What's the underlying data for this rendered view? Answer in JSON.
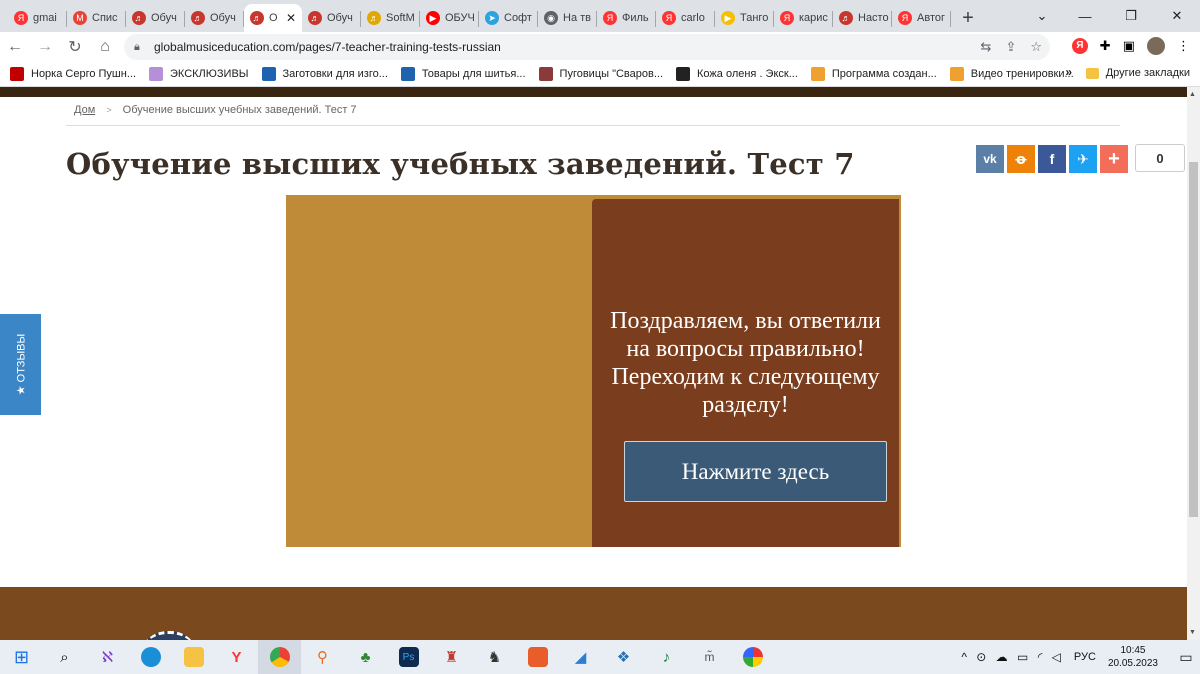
{
  "browser": {
    "tabs": [
      {
        "label": "gmai",
        "color": "#f33",
        "glyph": "Я"
      },
      {
        "label": "Спис",
        "color": "#ea4335",
        "glyph": "M"
      },
      {
        "label": "Обуч",
        "color": "#c8372d",
        "glyph": "♬"
      },
      {
        "label": "Обуч",
        "color": "#c8372d",
        "glyph": "♬"
      },
      {
        "label": "О",
        "color": "#c8372d",
        "glyph": "♬",
        "active": true
      },
      {
        "label": "Обуч",
        "color": "#c8372d",
        "glyph": "♬"
      },
      {
        "label": "SoftM",
        "color": "#e0a800",
        "glyph": "♬"
      },
      {
        "label": "ОБУЧ",
        "color": "#ff0000",
        "glyph": "▶"
      },
      {
        "label": "Софт",
        "color": "#2aa3df",
        "glyph": "➤"
      },
      {
        "label": "На тв",
        "color": "#5f6368",
        "glyph": "◉"
      },
      {
        "label": "Филь",
        "color": "#f33",
        "glyph": "Я"
      },
      {
        "label": "carlo",
        "color": "#f33",
        "glyph": "Я"
      },
      {
        "label": "Танго",
        "color": "#f5c000",
        "glyph": "▶"
      },
      {
        "label": "карис",
        "color": "#f33",
        "glyph": "Я"
      },
      {
        "label": "Насто",
        "color": "#c8372d",
        "glyph": "♬"
      },
      {
        "label": "Автог",
        "color": "#f33",
        "glyph": "Я"
      }
    ],
    "new_tab": "+",
    "tab_close": "✕",
    "url": "globalmusiceducation.com/pages/7-teacher-training-tests-russian",
    "bookmarks": [
      {
        "label": "Норка Серго Пушн...",
        "color": "#c00000"
      },
      {
        "label": "ЭКСКЛЮЗИВЫ",
        "color": "#b58fd8"
      },
      {
        "label": "Заготовки для изго...",
        "color": "#1e62b0"
      },
      {
        "label": "Товары для шитья...",
        "color": "#1e62b0"
      },
      {
        "label": "Пуговицы \"Сваров...",
        "color": "#8b3a3a"
      },
      {
        "label": "Кожа оленя . Экск...",
        "color": "#222"
      },
      {
        "label": "Программа создан...",
        "color": "#f0a030"
      },
      {
        "label": "Видео тренировки...",
        "color": "#f0a030"
      }
    ],
    "bookmarks_more": "»",
    "other_bookmarks": "Другие закладки"
  },
  "page": {
    "breadcrumb_home": "Дом",
    "breadcrumb_sep": ">",
    "breadcrumb_current": "Обучение высших учебных заведений. Тест 7",
    "title": "Обучение высших учебных заведений. Тест 7",
    "share_count": "0",
    "quiz_message": "Поздравляем, вы ответили на вопросы правильно! Переходим к следующему разделу!",
    "quiz_button": "Нажмите здесь",
    "reviews_tab": "★ ОТЗЫВЫ"
  },
  "taskbar": {
    "language": "РУС",
    "time": "10:45",
    "date": "20.05.2023"
  }
}
